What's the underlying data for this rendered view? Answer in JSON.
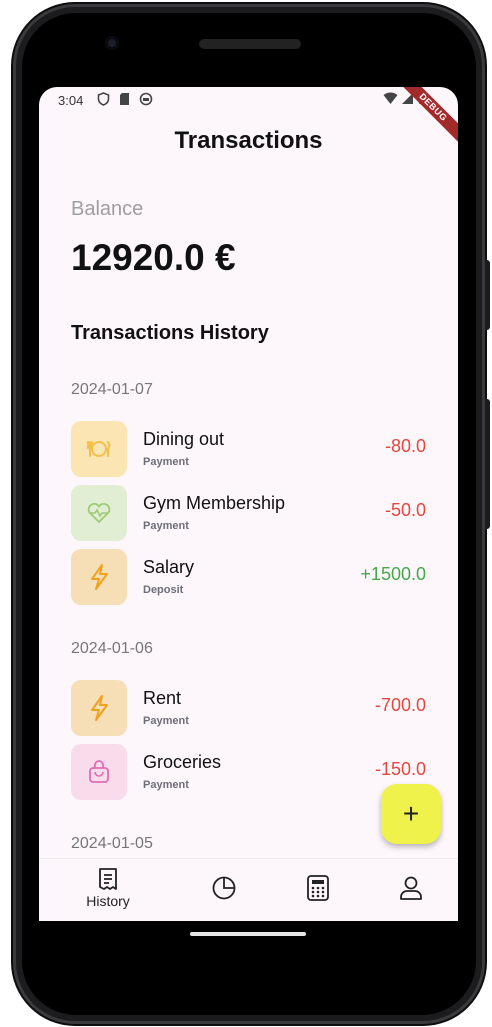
{
  "status_bar": {
    "time": "3:04",
    "debug_banner": "DEBUG"
  },
  "app_bar": {
    "title": "Transactions"
  },
  "balance": {
    "label": "Balance",
    "value": "12920.0 €"
  },
  "history": {
    "title": "Transactions History",
    "groups": [
      {
        "date": "2024-01-07",
        "items": [
          {
            "name": "Dining out",
            "type": "Payment",
            "amount": "-80.0",
            "icon": "restaurant-icon",
            "color": "#fbe6b3"
          },
          {
            "name": "Gym Membership",
            "type": "Payment",
            "amount": "-50.0",
            "icon": "heart-pulse-icon",
            "color": "#e2eed3"
          },
          {
            "name": "Salary",
            "type": "Deposit",
            "amount": "+1500.0",
            "icon": "lightning-icon",
            "color": "#f6deb6"
          }
        ]
      },
      {
        "date": "2024-01-06",
        "items": [
          {
            "name": "Rent",
            "type": "Payment",
            "amount": "-700.0",
            "icon": "lightning-icon",
            "color": "#f6deb6"
          },
          {
            "name": "Groceries",
            "type": "Payment",
            "amount": "-150.0",
            "icon": "shopping-bag-icon",
            "color": "#f8dcec"
          }
        ]
      },
      {
        "date": "2024-01-05",
        "items": []
      }
    ]
  },
  "fab": {
    "label": "+"
  },
  "bottom_nav": [
    {
      "label": "History",
      "icon": "receipt-icon",
      "selected": true
    },
    {
      "label": "",
      "icon": "pie-chart-icon"
    },
    {
      "label": "",
      "icon": "calculator-icon"
    },
    {
      "label": "",
      "icon": "person-icon"
    }
  ],
  "colors": {
    "negative": "#e5473e",
    "positive": "#45a84a",
    "fab": "#eef24a",
    "background": "#fdf7fb"
  }
}
